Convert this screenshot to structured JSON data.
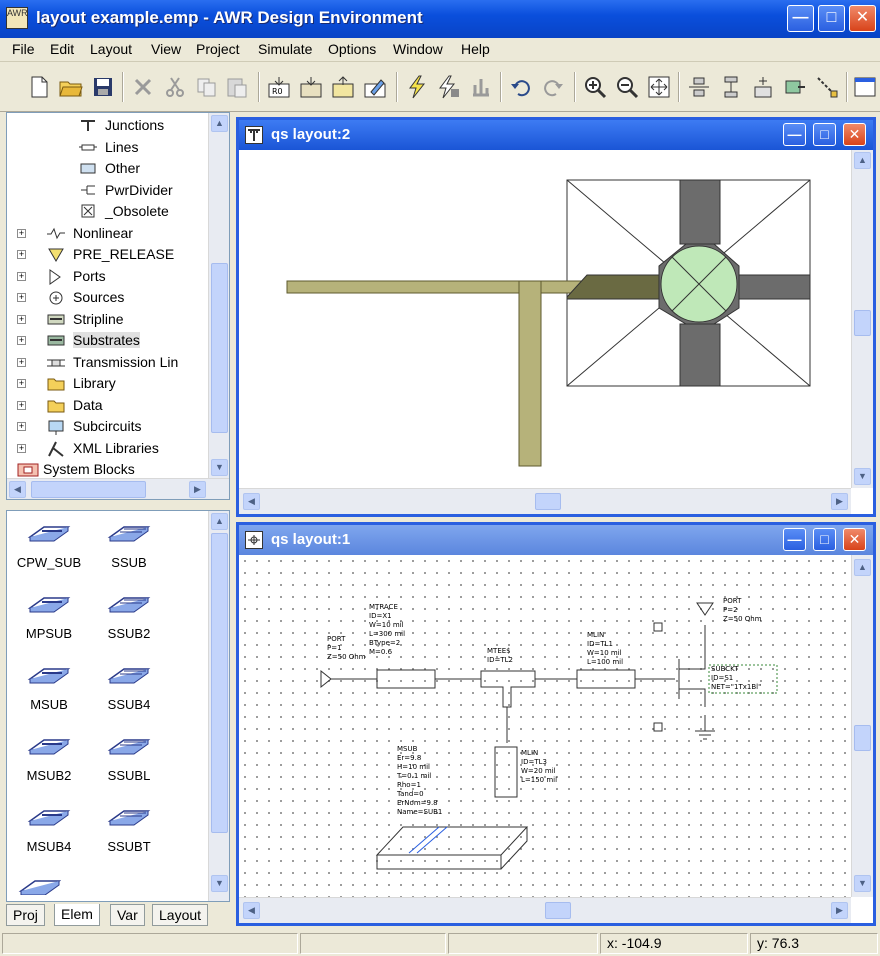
{
  "window": {
    "title": "layout example.emp - AWR Design Environment",
    "icon_text": "AWR"
  },
  "menu": [
    "File",
    "Edit",
    "Layout",
    "View",
    "Project",
    "Simulate",
    "Options",
    "Window",
    "Help"
  ],
  "tree": {
    "items": [
      {
        "label": "Junctions",
        "icon": "junction-icon"
      },
      {
        "label": "Lines",
        "icon": "line-icon"
      },
      {
        "label": "Other",
        "icon": "other-icon"
      },
      {
        "label": "PwrDivider",
        "icon": "power-divider-icon"
      },
      {
        "label": "_Obsolete",
        "icon": "obsolete-icon"
      },
      {
        "label": "Nonlinear",
        "icon": "nonlinear-icon"
      },
      {
        "label": "PRE_RELEASE",
        "icon": "pre-release-icon"
      },
      {
        "label": "Ports",
        "icon": "port-icon"
      },
      {
        "label": "Sources",
        "icon": "source-icon"
      },
      {
        "label": "Stripline",
        "icon": "stripline-icon"
      },
      {
        "label": "Substrates",
        "icon": "substrate-icon"
      },
      {
        "label": "Transmission Lin",
        "icon": "transmission-line-icon"
      },
      {
        "label": "Library",
        "icon": "folder-icon"
      },
      {
        "label": "Data",
        "icon": "folder-icon"
      },
      {
        "label": "Subcircuits",
        "icon": "subcircuit-icon"
      },
      {
        "label": "XML Libraries",
        "icon": "xml-library-icon"
      },
      {
        "label": "System Blocks",
        "icon": "system-blocks-icon"
      }
    ]
  },
  "elements": [
    {
      "label": "CPW_SUB"
    },
    {
      "label": "SSUB"
    },
    {
      "label": "MPSUB"
    },
    {
      "label": "SSUB2"
    },
    {
      "label": "MSUB"
    },
    {
      "label": "SSUB4"
    },
    {
      "label": "MSUB2"
    },
    {
      "label": "SSUBL"
    },
    {
      "label": "MSUB4"
    },
    {
      "label": "SSUBT"
    }
  ],
  "tabs": [
    "Proj",
    "Elem",
    "Var",
    "Layout"
  ],
  "layout_window": {
    "title": "qs layout:2"
  },
  "schematic_window": {
    "title": "qs layout:1",
    "labels": {
      "mtrace": [
        "MTRACE",
        "ID=X1",
        "W=10 mil",
        "L=300 mil",
        "BType=2",
        "M=0.6"
      ],
      "port1": [
        "PORT",
        "P=1",
        "Z=50 Ohm"
      ],
      "mtee": [
        "MTEE$",
        "ID=TL2"
      ],
      "mlin1": [
        "MLIN",
        "ID=TL1",
        "W=10 mil",
        "L=100 mil"
      ],
      "port2": [
        "PORT",
        "P=2",
        "Z=50 Ohm"
      ],
      "subckt": [
        "SUBCKT",
        "ID=S1",
        "NET=\"1Tx1Bl\""
      ],
      "mlin2": [
        "MLIN",
        "ID=TL3",
        "W=20 mil",
        "L=150 mil"
      ],
      "msub": [
        "MSUB",
        "Er=9.8",
        "H=10 mil",
        "T=0.1 mil",
        "Rho=1",
        "Tand=0",
        "ErNom=9.8",
        "Name=SUB1"
      ]
    }
  },
  "status": {
    "x_label": "x:",
    "x_value": "-104.9",
    "y_label": "y:",
    "y_value": "76.3"
  },
  "colors": {
    "title_blue": "#0a4fdc",
    "trace_olive": "#b6b27a",
    "trace_edge": "#5e5a2e",
    "pad_gray": "#6c6c6c",
    "via_green": "#bfe8b8"
  }
}
